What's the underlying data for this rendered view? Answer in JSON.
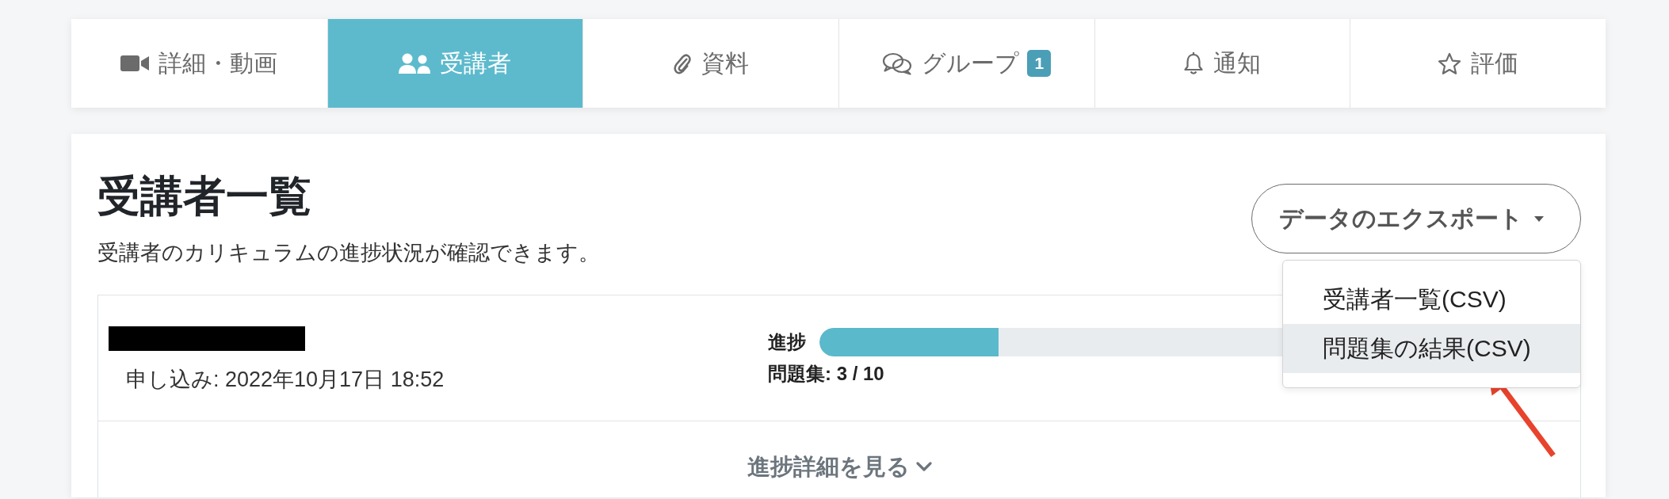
{
  "tabs": [
    {
      "label": "詳細・動画",
      "selected": false
    },
    {
      "label": "受講者",
      "selected": true
    },
    {
      "label": "資料",
      "selected": false
    },
    {
      "label": "グループ",
      "selected": false,
      "badge": "1"
    },
    {
      "label": "通知",
      "selected": false
    },
    {
      "label": "評価",
      "selected": false
    }
  ],
  "panel": {
    "title": "受講者一覧",
    "subtitle": "受講者のカリキュラムの進捗状況が確認できます。",
    "export": {
      "label": "データのエクスポート",
      "expanded": true,
      "menu": [
        {
          "label": "受講者一覧(CSV)",
          "selected": false
        },
        {
          "label": "問題集の結果(CSV)",
          "selected": true
        }
      ]
    },
    "students": [
      {
        "redacted": true,
        "applied": "申し込み: 2022年10月17日 18:52",
        "progress_label": "進捗",
        "level": 0.3,
        "count": "問題集: 3 / 10",
        "details_toggle": "進捗詳細を見る"
      }
    ]
  },
  "annotation": {
    "kind": "arrow"
  }
}
